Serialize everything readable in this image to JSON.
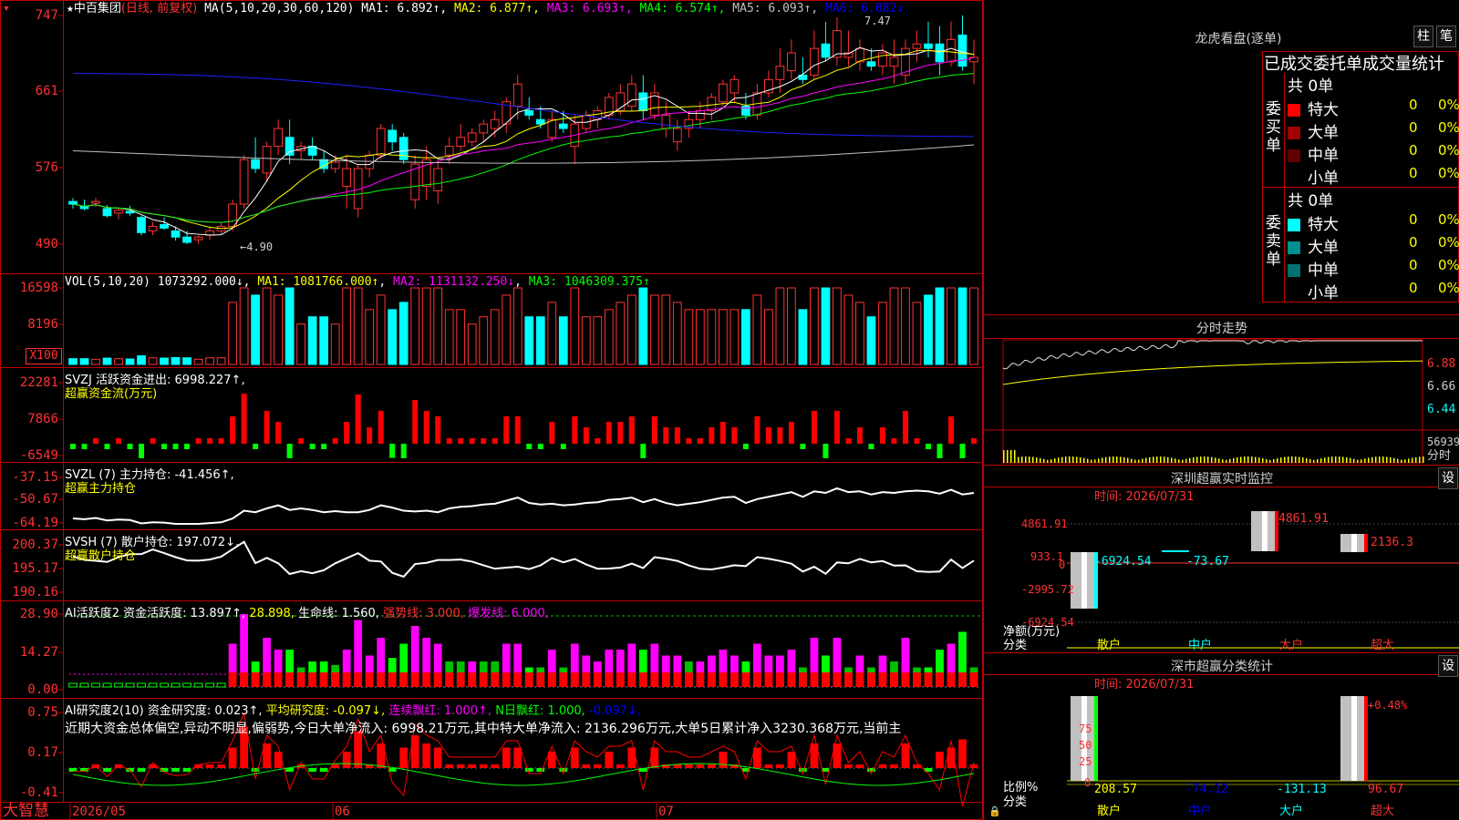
{
  "header": {
    "star": "★",
    "stock_name": "中百集团",
    "mode": "(日线, 前复权)",
    "ma_label": "MA(5,10,20,30,60,120)",
    "ma_values": [
      {
        "label": "MA1: 6.892↑",
        "color": "#ffffff"
      },
      {
        "label": "MA2: 6.877↑",
        "color": "#ffff00"
      },
      {
        "label": "MA3: 6.693↑",
        "color": "#ff00ff"
      },
      {
        "label": "MA4: 6.574↑",
        "color": "#00ff00"
      },
      {
        "label": "MA5: 6.093↑",
        "color": "#c0c0c0"
      },
      {
        "label": "MA6: 6.082↓",
        "color": "#0000ff"
      }
    ]
  },
  "main_panel": {
    "y_labels": [
      "747",
      "661",
      "576",
      "490"
    ],
    "high_marker": "7.47",
    "low_marker": "←4.90"
  },
  "vol_panel": {
    "title": "VOL(5,10,20)",
    "value": "1073292.000↓",
    "ma1": "MA1: 1081766.000↑",
    "ma2": "MA2: 1131132.250↓",
    "ma3": "MA3: 1046309.375↑",
    "y_labels": [
      "16598",
      "8196"
    ],
    "unit": "X100"
  },
  "svzj_panel": {
    "title": "SVZJ  活跃资金进出: 6998.227↑,",
    "subtitle": "超赢资金流(万元)",
    "y_labels": [
      "22281",
      "7866",
      "-6549"
    ]
  },
  "svzl_panel": {
    "title": "SVZL (7) 主力持仓: -41.456↑,",
    "subtitle": "超赢主力持仓",
    "y_labels": [
      "-37.15",
      "-50.67",
      "-64.19"
    ]
  },
  "svsh_panel": {
    "title": "SVSH (7) 散户持仓: 197.072↓,",
    "subtitle": "超赢散户持仓",
    "y_labels": [
      "200.37",
      "195.17",
      "190.16"
    ]
  },
  "ai2_panel": {
    "title_a": "AI活跃度2 资金活跃度: 13.897↑,",
    "title_b": "28.898,",
    "title_c": "生命线: 1.560,",
    "title_d": "强势线: 3.000,",
    "title_e": "爆发线: 6.000,",
    "y_labels": [
      "28.90",
      "14.27",
      "0.00"
    ]
  },
  "ai_research_panel": {
    "title_a": "AI研究度2(10) 资金研究度: 0.023↑,",
    "title_b": "平均研究度: -0.097↓,",
    "title_c": "连续飘红: 1.000↑,",
    "title_d": "N日飘红: 1.000,",
    "title_e": "-0.097↓,",
    "summary": "近期大资金总体偏空,异动不明显,偏弱势,今日大单净流入: 6998.21万元,其中特大单净流入: 2136.296万元,大单5日累计净入3230.368万元,当前主",
    "y_labels": [
      "0.75",
      "0.17",
      "-0.41"
    ]
  },
  "x_axis": {
    "brand": "大智慧",
    "labels": [
      "2026/05",
      "06",
      "07"
    ]
  },
  "right": {
    "dragon_tiger": "龙虎看盘(逐单)",
    "btn_bar": "柱",
    "btn_pen": "笔",
    "order_header": "已成交委托单成交量统计",
    "buy_label": "委买单",
    "sell_label": "委卖单",
    "buy_total": "共 0单",
    "sell_total": "共 0单",
    "buy_rows": [
      {
        "name": "特大",
        "count": "0",
        "pct": "0%",
        "color": "#ff0000"
      },
      {
        "name": "大单",
        "count": "0",
        "pct": "0%",
        "color": "#a00000"
      },
      {
        "name": "中单",
        "count": "0",
        "pct": "0%",
        "color": "#600000"
      },
      {
        "name": "小单",
        "count": "0",
        "pct": "0%",
        "color": "#000000"
      }
    ],
    "sell_rows": [
      {
        "name": "特大",
        "count": "0",
        "pct": "0%",
        "color": "#00ffff"
      },
      {
        "name": "大单",
        "count": "0",
        "pct": "0%",
        "color": "#009090"
      },
      {
        "name": "中单",
        "count": "0",
        "pct": "0%",
        "color": "#007070"
      },
      {
        "name": "小单",
        "count": "0",
        "pct": "0%",
        "color": "#000000"
      }
    ],
    "intraday_title": "分时走势",
    "intraday_prices": [
      "6.88",
      "6.66",
      "6.44"
    ],
    "intraday_vol": "56939",
    "intraday_unit": "分时",
    "sz_monitor_title": "深圳超赢实时监控",
    "sz_monitor_btn": "设",
    "sz_time": "时间: 2026/07/31",
    "sz_y_labels": [
      "4861.91",
      "933.1",
      "0",
      "-2995.72",
      "-6924.54"
    ],
    "sz_net_label": "净额(万元)",
    "sz_class_label": "分类",
    "sz_bar_values": [
      "-6924.54",
      "-73.67",
      "4861.91",
      "2136.3"
    ],
    "sz_categories": [
      "散户",
      "中户",
      "大户",
      "超大"
    ],
    "stat_title": "深市超赢分类统计",
    "stat_btn": "设",
    "stat_time": "时间: 2026/07/31",
    "stat_y_labels": [
      "75",
      "50",
      "25",
      "0"
    ],
    "stat_pct_label": "比例%",
    "stat_class_label": "分类",
    "stat_bar_top": "+0.48%",
    "stat_values": [
      "208.57",
      "-74.12",
      "-131.13",
      "96.67"
    ],
    "stat_categories": [
      "散户",
      "中户",
      "大户",
      "超大"
    ]
  },
  "chart_data": [
    {
      "type": "candlestick",
      "title": "中百集团 (日线, 前复权)",
      "ylim": [
        4.9,
        7.47
      ],
      "dates_range": [
        "2026/05",
        "2026/07"
      ],
      "candles": [
        [
          5.38,
          5.42,
          5.3,
          5.35
        ],
        [
          5.33,
          5.4,
          5.28,
          5.3
        ],
        [
          5.36,
          5.42,
          5.32,
          5.38
        ],
        [
          5.3,
          5.34,
          5.2,
          5.22
        ],
        [
          5.25,
          5.3,
          5.18,
          5.28
        ],
        [
          5.27,
          5.33,
          5.22,
          5.25
        ],
        [
          5.2,
          5.22,
          5.0,
          5.03
        ],
        [
          5.05,
          5.15,
          5.0,
          5.1
        ],
        [
          5.12,
          5.2,
          5.06,
          5.08
        ],
        [
          5.05,
          5.1,
          4.94,
          4.98
        ],
        [
          4.98,
          5.05,
          4.9,
          4.92
        ],
        [
          4.95,
          5.0,
          4.9,
          4.98
        ],
        [
          5.0,
          5.1,
          4.95,
          5.05
        ],
        [
          5.05,
          5.15,
          5.0,
          5.1
        ],
        [
          5.1,
          5.4,
          5.05,
          5.35
        ],
        [
          5.35,
          5.9,
          5.3,
          5.85
        ],
        [
          5.85,
          6.1,
          5.7,
          5.75
        ],
        [
          5.7,
          6.05,
          5.6,
          6.0
        ],
        [
          6.0,
          6.3,
          5.9,
          6.2
        ],
        [
          6.1,
          6.3,
          5.8,
          5.9
        ],
        [
          5.95,
          6.05,
          5.85,
          6.0
        ],
        [
          6.0,
          6.1,
          5.85,
          5.9
        ],
        [
          5.85,
          5.95,
          5.7,
          5.75
        ],
        [
          5.75,
          5.9,
          5.7,
          5.82
        ],
        [
          5.55,
          5.9,
          5.3,
          5.75
        ],
        [
          5.3,
          5.8,
          5.2,
          5.75
        ],
        [
          5.75,
          5.95,
          5.65,
          5.9
        ],
        [
          5.9,
          6.25,
          5.85,
          6.2
        ],
        [
          6.18,
          6.25,
          5.95,
          6.05
        ],
        [
          6.1,
          6.15,
          5.8,
          5.85
        ],
        [
          5.4,
          5.9,
          5.3,
          5.8
        ],
        [
          5.55,
          6.0,
          5.4,
          5.85
        ],
        [
          5.5,
          5.85,
          5.35,
          5.75
        ],
        [
          5.9,
          6.1,
          5.8,
          6.0
        ],
        [
          6.0,
          6.25,
          5.95,
          6.1
        ],
        [
          6.05,
          6.2,
          6.0,
          6.15
        ],
        [
          6.15,
          6.3,
          6.05,
          6.25
        ],
        [
          6.2,
          6.4,
          6.1,
          6.3
        ],
        [
          6.25,
          6.55,
          6.15,
          6.5
        ],
        [
          6.45,
          6.8,
          6.3,
          6.7
        ],
        [
          6.4,
          6.55,
          6.3,
          6.35
        ],
        [
          6.3,
          6.45,
          6.2,
          6.25
        ],
        [
          6.1,
          6.4,
          6.05,
          6.3
        ],
        [
          6.25,
          6.4,
          6.15,
          6.2
        ],
        [
          6.0,
          6.35,
          5.8,
          6.25
        ],
        [
          6.2,
          6.4,
          6.15,
          6.35
        ],
        [
          6.3,
          6.45,
          6.2,
          6.4
        ],
        [
          6.35,
          6.6,
          6.3,
          6.55
        ],
        [
          6.4,
          6.7,
          6.35,
          6.6
        ],
        [
          6.45,
          6.8,
          6.4,
          6.7
        ],
        [
          6.6,
          6.8,
          6.3,
          6.4
        ],
        [
          6.35,
          6.7,
          6.3,
          6.6
        ],
        [
          6.2,
          6.5,
          6.1,
          6.35
        ],
        [
          6.05,
          6.3,
          5.95,
          6.2
        ],
        [
          6.2,
          6.4,
          6.1,
          6.3
        ],
        [
          6.3,
          6.5,
          6.2,
          6.4
        ],
        [
          6.4,
          6.6,
          6.3,
          6.55
        ],
        [
          6.5,
          6.75,
          6.45,
          6.7
        ],
        [
          6.6,
          6.8,
          6.5,
          6.75
        ],
        [
          6.45,
          6.6,
          6.3,
          6.35
        ],
        [
          6.35,
          6.7,
          6.3,
          6.6
        ],
        [
          6.6,
          6.85,
          6.55,
          6.75
        ],
        [
          6.75,
          7.1,
          6.6,
          6.9
        ],
        [
          6.85,
          7.2,
          6.75,
          7.05
        ],
        [
          6.8,
          7.0,
          6.7,
          6.75
        ],
        [
          6.8,
          7.3,
          6.75,
          7.1
        ],
        [
          7.15,
          7.4,
          6.95,
          7.0
        ],
        [
          7.0,
          7.45,
          6.9,
          7.3
        ],
        [
          7.0,
          7.3,
          6.9,
          7.05
        ],
        [
          6.95,
          7.2,
          6.85,
          7.1
        ],
        [
          6.95,
          7.1,
          6.85,
          6.9
        ],
        [
          6.9,
          7.15,
          6.8,
          7.05
        ],
        [
          6.9,
          7.2,
          6.7,
          7.0
        ],
        [
          6.8,
          7.2,
          6.7,
          7.1
        ],
        [
          7.1,
          7.3,
          6.95,
          7.15
        ],
        [
          7.15,
          7.4,
          7.0,
          7.1
        ],
        [
          7.15,
          7.35,
          6.8,
          6.95
        ],
        [
          6.95,
          7.4,
          6.9,
          7.2
        ],
        [
          7.25,
          7.47,
          6.85,
          6.9
        ],
        [
          6.95,
          7.2,
          6.7,
          7.0
        ]
      ]
    }
  ]
}
